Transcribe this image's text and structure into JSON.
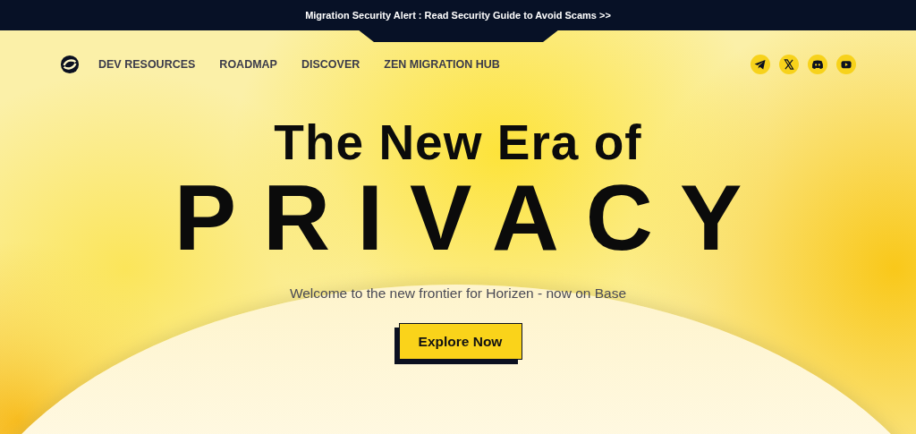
{
  "alert_banner": {
    "text": "Migration Security Alert : Read Security Guide to Avoid Scams >>"
  },
  "nav": {
    "items": [
      {
        "label": "DEV RESOURCES"
      },
      {
        "label": "ROADMAP"
      },
      {
        "label": "DISCOVER"
      },
      {
        "label": "ZEN MIGRATION HUB"
      }
    ],
    "social": [
      {
        "kind": "telegram"
      },
      {
        "kind": "x"
      },
      {
        "kind": "discord"
      },
      {
        "kind": "youtube"
      }
    ]
  },
  "hero": {
    "title": "The New Era of",
    "headline": "PRIVACY",
    "subtitle": "Welcome to the new frontier for Horizen - now on Base",
    "button": "Explore Now"
  }
}
